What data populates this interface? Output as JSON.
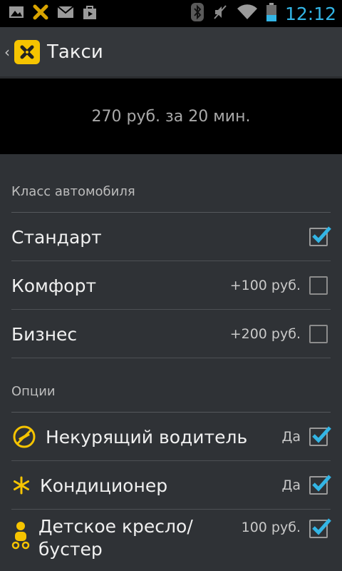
{
  "statusbar": {
    "time": "12:12",
    "icons": [
      "image-icon",
      "taxi-app-icon",
      "gmail-icon",
      "shop-bag-icon",
      "bluetooth-icon",
      "mute-icon",
      "wifi-icon",
      "battery-icon"
    ],
    "accent": "#33b5e5"
  },
  "actionbar": {
    "back": "‹",
    "title": "Такси",
    "logo_color": "#f6c400"
  },
  "price": {
    "text": "270 руб. за 20 мин."
  },
  "car_class": {
    "header": "Класс автомобиля",
    "items": [
      {
        "label": "Стандарт",
        "extra": "",
        "checked": true
      },
      {
        "label": "Комфорт",
        "extra": "+100 руб.",
        "checked": false
      },
      {
        "label": "Бизнес",
        "extra": "+200 руб.",
        "checked": false
      }
    ]
  },
  "options": {
    "header": "Опции",
    "items": [
      {
        "icon": "no-smoking-icon",
        "label": "Некурящий водитель",
        "extra": "Да",
        "checked": true
      },
      {
        "icon": "snowflake-icon",
        "label": "Кондиционер",
        "extra": "Да",
        "checked": true
      },
      {
        "icon": "child-seat-icon",
        "label_line1": "Детское кресло/",
        "label_line2": "бустер",
        "extra": "100 руб.",
        "checked": true
      }
    ]
  }
}
